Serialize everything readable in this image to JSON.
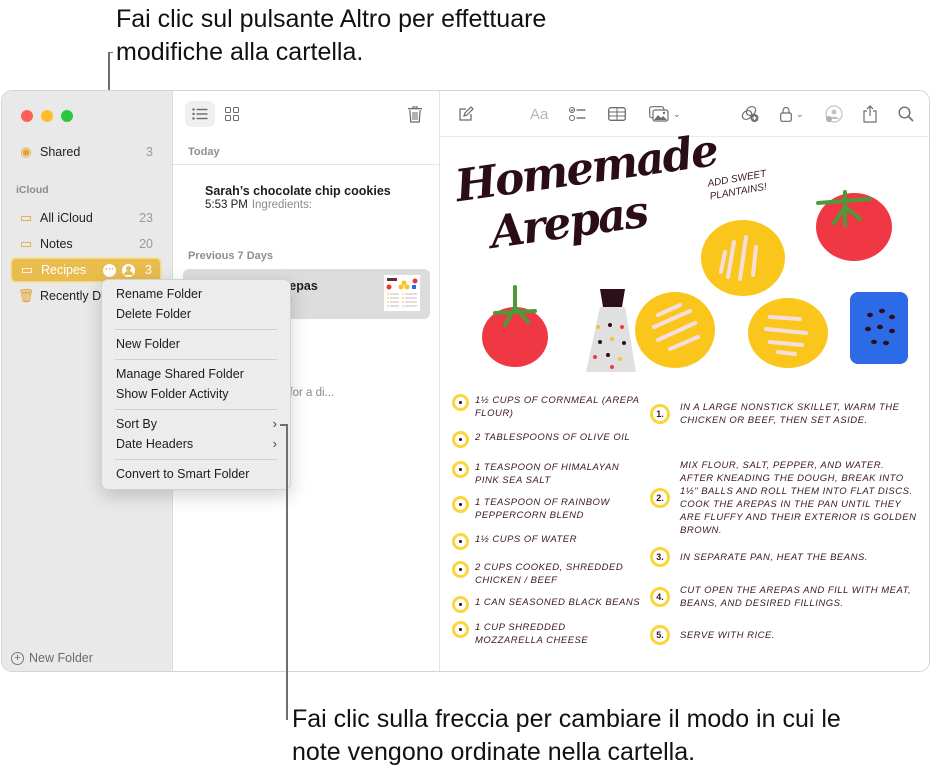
{
  "callouts": {
    "top": "Fai clic sul pulsante Altro per effettuare modifiche alla cartella.",
    "bottom": "Fai clic sulla freccia per cambiare il modo in cui le note vengono ordinate nella cartella."
  },
  "colors": {
    "accent": "#e8bd4e",
    "ink": "#3e1824",
    "bullet": "#fcd53a"
  },
  "sidebar": {
    "shared": {
      "label": "Shared",
      "count": "3",
      "icon": "person-circle-icon"
    },
    "section": "iCloud",
    "folders": [
      {
        "label": "All iCloud",
        "count": "23",
        "icon": "folder-icon"
      },
      {
        "label": "Notes",
        "count": "20",
        "icon": "folder-icon"
      },
      {
        "label": "Recipes",
        "count": "3",
        "icon": "shared-folder-icon",
        "selected": true
      },
      {
        "label": "Recently Deleted",
        "count": "",
        "icon": "trash-icon"
      }
    ],
    "new_folder": "New Folder"
  },
  "context_menu": {
    "items": [
      "Rename Folder",
      "Delete Folder",
      "New Folder",
      "Manage Shared Folder",
      "Show Folder Activity",
      "Sort By",
      "Date Headers",
      "Convert to Smart Folder"
    ],
    "submenu_arrow": "›"
  },
  "list": {
    "sections": [
      "Today",
      "Previous 7 Days"
    ],
    "notes": [
      {
        "title": "Sarah’s chocolate chip cookies",
        "time": "5:53 PM",
        "preview": "Ingredients:"
      },
      {
        "title": "Homemade Arepas",
        "time": "",
        "preview": "Handwritten note",
        "selected": true
      },
      {
        "title": "",
        "time": "",
        "preview": "Chicken piccata for a di..."
      }
    ],
    "visible_fragments": {
      "arepas_title": "epas",
      "arepas_preview": "ritten note",
      "piccata_preview": "cken piccata for a di..."
    }
  },
  "editor": {
    "toolbar": [
      "compose-icon",
      "format-icon",
      "checklist-icon",
      "table-icon",
      "media-icon",
      "collaborate-icon",
      "lock-icon",
      "activity-icon",
      "share-icon",
      "search-icon"
    ],
    "format_label": "Aa",
    "note": {
      "title_line1": "Homemade",
      "title_line2": "Arepas",
      "side_note": "Add sweet plantains!",
      "ingredients": [
        "1½ cups of cornmeal (arepa flour)",
        "2 tablespoons of olive oil",
        "1 teaspoon of Himalayan pink sea salt",
        "1 teaspoon of rainbow peppercorn blend",
        "1½ cups of water",
        "2 cups cooked, shredded chicken / beef",
        "1 can seasoned black beans",
        "1 cup shredded mozzarella cheese"
      ],
      "steps": [
        {
          "num": "1.",
          "text": "In a large nonstick skillet, warm the chicken or beef, then set aside."
        },
        {
          "num": "2.",
          "text": "Mix flour, salt, pepper, and water. After kneading the dough, break into 1½\" balls and roll them into flat discs. Cook the arepas in the pan until they are fluffy and their exterior is golden brown."
        },
        {
          "num": "3.",
          "text": "In separate pan, heat the beans."
        },
        {
          "num": "4.",
          "text": "Cut open the arepas and fill with meat, beans, and desired fillings."
        },
        {
          "num": "5.",
          "text": "Serve with rice."
        }
      ]
    }
  }
}
